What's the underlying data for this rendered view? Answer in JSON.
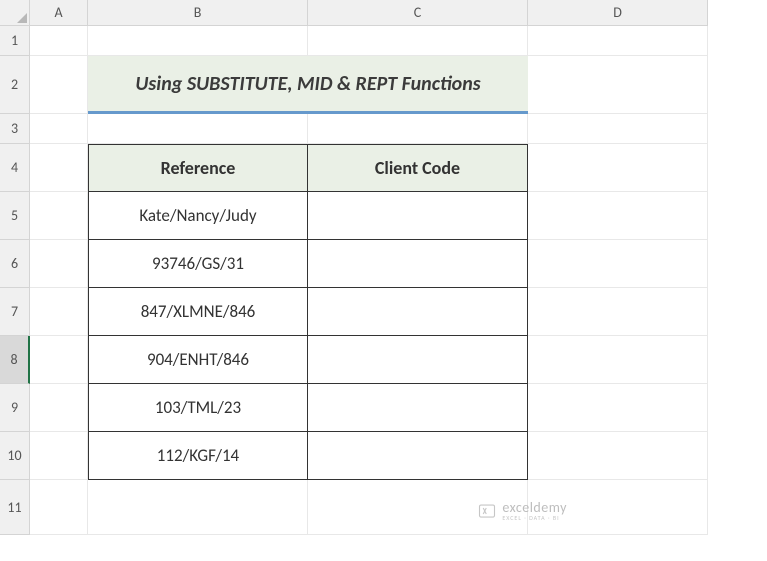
{
  "columns": [
    "A",
    "B",
    "C",
    "D"
  ],
  "rows": [
    "1",
    "2",
    "3",
    "4",
    "5",
    "6",
    "7",
    "8",
    "9",
    "10",
    "11"
  ],
  "selectedRow": "8",
  "title": "Using SUBSTITUTE, MID & REPT Functions",
  "table": {
    "headers": {
      "reference": "Reference",
      "clientCode": "Client Code"
    },
    "rows": [
      {
        "reference": "Kate/Nancy/Judy",
        "clientCode": ""
      },
      {
        "reference": "93746/GS/31",
        "clientCode": ""
      },
      {
        "reference": "847/XLMNE/846",
        "clientCode": ""
      },
      {
        "reference": "904/ENHT/846",
        "clientCode": ""
      },
      {
        "reference": "103/TML/23",
        "clientCode": ""
      },
      {
        "reference": "112/KGF/14",
        "clientCode": ""
      }
    ]
  },
  "watermark": {
    "main": "exceldemy",
    "sub": "EXCEL · DATA · BI"
  }
}
